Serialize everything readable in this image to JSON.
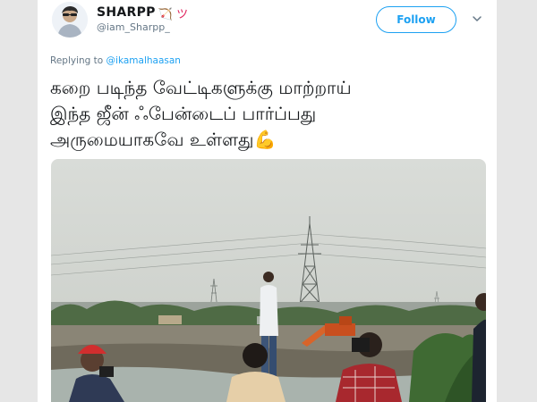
{
  "tweet": {
    "display_name": "SHARPP",
    "name_emoji": "🏹 ツ",
    "handle": "@iam_Sharpp_",
    "follow_label": "Follow",
    "replying_prefix": "Replying to",
    "replying_handle": "@ikamalhaasan",
    "text_lines": [
      "கறை படிந்த வேட்டிகளுக்கு மாற்றாய்",
      "இந்த ஜீன் ஃபேன்டைப் பார்ப்பது",
      "அருமையாகவே உள்ளது"
    ],
    "emoji": "💪"
  },
  "colors": {
    "accent": "#1da1f2",
    "text": "#14171a",
    "muted": "#657786"
  },
  "icons": {
    "chevron": "chevron-down-icon",
    "avatar": "avatar"
  }
}
